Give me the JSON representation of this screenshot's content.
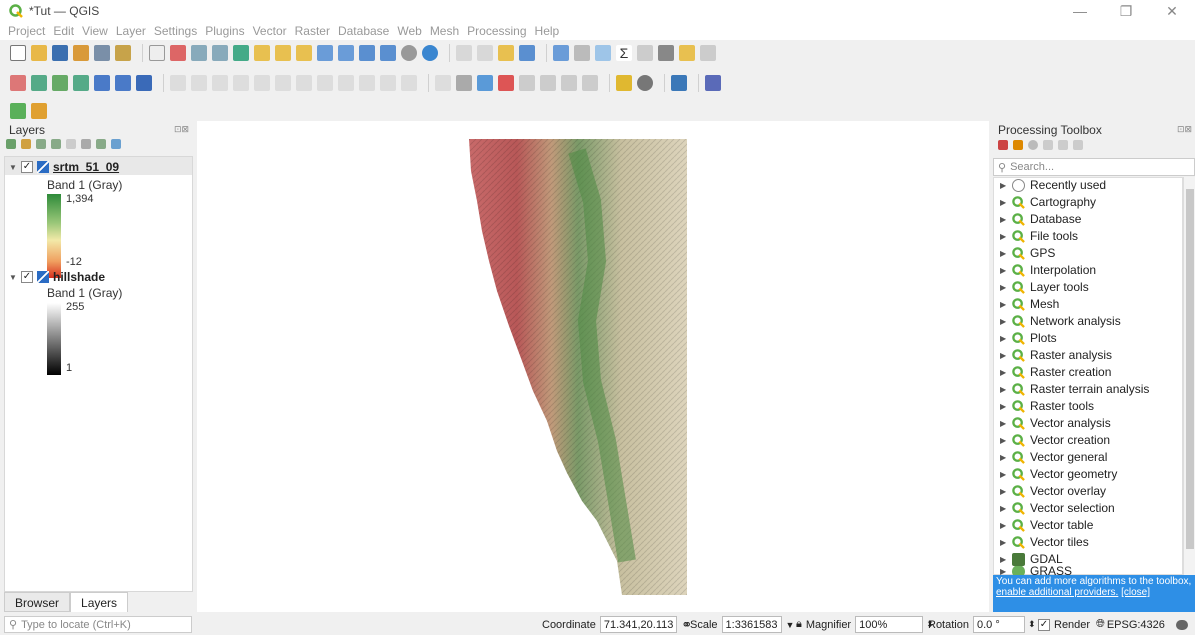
{
  "app": {
    "title": "*Tut — QGIS"
  },
  "window_controls": {
    "minimize": "—",
    "maximize": "❐",
    "close": "✕"
  },
  "menu": [
    "Project",
    "Edit",
    "View",
    "Layer",
    "Settings",
    "Plugins",
    "Vector",
    "Raster",
    "Database",
    "Web",
    "Mesh",
    "Processing",
    "Help"
  ],
  "layers_panel": {
    "title": "Layers",
    "layers": [
      {
        "name": "srtm_51_09",
        "checked": "✓",
        "band": "Band 1 (Gray)",
        "max": "1,394",
        "min": "-12"
      },
      {
        "name": "hillshade",
        "checked": "✓",
        "band": "Band 1 (Gray)",
        "max": "255",
        "min": "1"
      }
    ],
    "tabs": [
      "Browser",
      "Layers"
    ]
  },
  "toolbox": {
    "title": "Processing Toolbox",
    "search_placeholder": "Search...",
    "items": [
      "Recently used",
      "Cartography",
      "Database",
      "File tools",
      "GPS",
      "Interpolation",
      "Layer tools",
      "Mesh",
      "Network analysis",
      "Plots",
      "Raster analysis",
      "Raster creation",
      "Raster terrain analysis",
      "Raster tools",
      "Vector analysis",
      "Vector creation",
      "Vector general",
      "Vector geometry",
      "Vector overlay",
      "Vector selection",
      "Vector table",
      "Vector tiles",
      "GDAL",
      "GRASS"
    ],
    "info_text": "You can add more algorithms to the toolbox,",
    "info_link": "enable additional providers.",
    "info_close": "[close]"
  },
  "status": {
    "locate_placeholder": "Type to locate (Ctrl+K)",
    "coordinate_label": "Coordinate",
    "coordinate_value": "71.341,20.113",
    "scale_label": "Scale",
    "scale_value": "1:3361583",
    "magnifier_label": "Magnifier",
    "magnifier_value": "100%",
    "rotation_label": "Rotation",
    "rotation_value": "0.0 °",
    "render_label": "Render",
    "render_checked": "✓",
    "crs": "EPSG:4326"
  },
  "colors": {
    "ramp_top": "#2e8b3a",
    "ramp_mid": "#f2e9a8",
    "ramp_bottom": "#d7301f",
    "info_bg": "#2e8fe6",
    "qgis_green": "#5bb046"
  }
}
